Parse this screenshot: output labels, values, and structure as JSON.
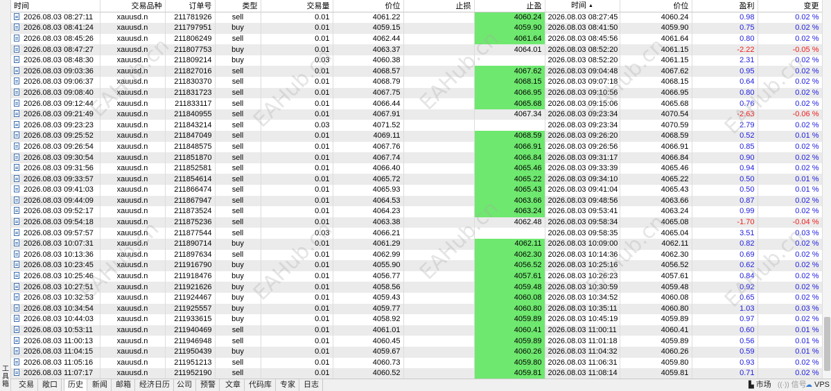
{
  "side_label": "工具箱",
  "columns": [
    "时间",
    "交易品种",
    "订单号",
    "类型",
    "交易量",
    "价位",
    "止损",
    "止盈",
    "时间",
    "价位",
    "盈利",
    "变更"
  ],
  "watermark": "EAHub.cn",
  "rows": [
    [
      "2026.08.03 08:27:11",
      "xauusd.n",
      "211781926",
      "sell",
      "0.01",
      "4061.22",
      "",
      "4060.24",
      "2026.08.03 08:27:45",
      "4060.24",
      "0.98",
      "0.02 %"
    ],
    [
      "2026.08.03 08:41:24",
      "xauusd.n",
      "211797951",
      "buy",
      "0.01",
      "4059.15",
      "",
      "4059.90",
      "2026.08.03 08:41:50",
      "4059.90",
      "0.75",
      "0.02 %"
    ],
    [
      "2026.08.03 08:45:26",
      "xauusd.n",
      "211806249",
      "sell",
      "0.01",
      "4062.44",
      "",
      "4061.64",
      "2026.08.03 08:45:56",
      "4061.64",
      "0.80",
      "0.02 %"
    ],
    [
      "2026.08.03 08:47:27",
      "xauusd.n",
      "211807753",
      "buy",
      "0.01",
      "4063.37",
      "",
      "4064.01",
      "2026.08.03 08:52:20",
      "4061.15",
      "-2.22",
      "-0.05 %"
    ],
    [
      "2026.08.03 08:48:30",
      "xauusd.n",
      "211809214",
      "buy",
      "0.03",
      "4060.38",
      "",
      "",
      "2026.08.03 08:52:20",
      "4061.15",
      "2.31",
      "0.02 %"
    ],
    [
      "2026.08.03 09:03:36",
      "xauusd.n",
      "211827016",
      "sell",
      "0.01",
      "4068.57",
      "",
      "4067.62",
      "2026.08.03 09:04:48",
      "4067.62",
      "0.95",
      "0.02 %"
    ],
    [
      "2026.08.03 09:06:37",
      "xauusd.n",
      "211830370",
      "sell",
      "0.01",
      "4068.79",
      "",
      "4068.15",
      "2026.08.03 09:07:18",
      "4068.15",
      "0.64",
      "0.02 %"
    ],
    [
      "2026.08.03 09:08:40",
      "xauusd.n",
      "211831723",
      "sell",
      "0.01",
      "4067.75",
      "",
      "4066.95",
      "2026.08.03 09:10:56",
      "4066.95",
      "0.80",
      "0.02 %"
    ],
    [
      "2026.08.03 09:12:44",
      "xauusd.n",
      "211833117",
      "sell",
      "0.01",
      "4066.44",
      "",
      "4065.68",
      "2026.08.03 09:15:06",
      "4065.68",
      "0.76",
      "0.02 %"
    ],
    [
      "2026.08.03 09:21:49",
      "xauusd.n",
      "211840955",
      "sell",
      "0.01",
      "4067.91",
      "",
      "4067.34",
      "2026.08.03 09:23:34",
      "4070.54",
      "-2.63",
      "-0.06 %"
    ],
    [
      "2026.08.03 09:23:23",
      "xauusd.n",
      "211843214",
      "sell",
      "0.03",
      "4071.52",
      "",
      "",
      "2026.08.03 09:23:34",
      "4070.59",
      "2.79",
      "0.02 %"
    ],
    [
      "2026.08.03 09:25:52",
      "xauusd.n",
      "211847049",
      "sell",
      "0.01",
      "4069.11",
      "",
      "4068.59",
      "2026.08.03 09:26:20",
      "4068.59",
      "0.52",
      "0.01 %"
    ],
    [
      "2026.08.03 09:26:54",
      "xauusd.n",
      "211848575",
      "sell",
      "0.01",
      "4067.76",
      "",
      "4066.91",
      "2026.08.03 09:26:56",
      "4066.91",
      "0.85",
      "0.02 %"
    ],
    [
      "2026.08.03 09:30:54",
      "xauusd.n",
      "211851870",
      "sell",
      "0.01",
      "4067.74",
      "",
      "4066.84",
      "2026.08.03 09:31:17",
      "4066.84",
      "0.90",
      "0.02 %"
    ],
    [
      "2026.08.03 09:31:56",
      "xauusd.n",
      "211852581",
      "sell",
      "0.01",
      "4066.40",
      "",
      "4065.46",
      "2026.08.03 09:33:39",
      "4065.46",
      "0.94",
      "0.02 %"
    ],
    [
      "2026.08.03 09:33:57",
      "xauusd.n",
      "211854614",
      "sell",
      "0.01",
      "4065.72",
      "",
      "4065.22",
      "2026.08.03 09:34:10",
      "4065.22",
      "0.50",
      "0.01 %"
    ],
    [
      "2026.08.03 09:41:03",
      "xauusd.n",
      "211866474",
      "sell",
      "0.01",
      "4065.93",
      "",
      "4065.43",
      "2026.08.03 09:41:04",
      "4065.43",
      "0.50",
      "0.01 %"
    ],
    [
      "2026.08.03 09:44:09",
      "xauusd.n",
      "211867947",
      "sell",
      "0.01",
      "4064.53",
      "",
      "4063.66",
      "2026.08.03 09:48:56",
      "4063.66",
      "0.87",
      "0.02 %"
    ],
    [
      "2026.08.03 09:52:17",
      "xauusd.n",
      "211873524",
      "sell",
      "0.01",
      "4064.23",
      "",
      "4063.24",
      "2026.08.03 09:53:41",
      "4063.24",
      "0.99",
      "0.02 %"
    ],
    [
      "2026.08.03 09:54:18",
      "xauusd.n",
      "211875236",
      "sell",
      "0.01",
      "4063.38",
      "",
      "4062.48",
      "2026.08.03 09:58:34",
      "4065.08",
      "-1.70",
      "-0.04 %"
    ],
    [
      "2026.08.03 09:57:57",
      "xauusd.n",
      "211877544",
      "sell",
      "0.03",
      "4066.21",
      "",
      "",
      "2026.08.03 09:58:35",
      "4065.04",
      "3.51",
      "0.03 %"
    ],
    [
      "2026.08.03 10:07:31",
      "xauusd.n",
      "211890714",
      "buy",
      "0.01",
      "4061.29",
      "",
      "4062.11",
      "2026.08.03 10:09:00",
      "4062.11",
      "0.82",
      "0.02 %"
    ],
    [
      "2026.08.03 10:13:36",
      "xauusd.n",
      "211897634",
      "sell",
      "0.01",
      "4062.99",
      "",
      "4062.30",
      "2026.08.03 10:14:36",
      "4062.30",
      "0.69",
      "0.02 %"
    ],
    [
      "2026.08.03 10:23:45",
      "xauusd.n",
      "211916790",
      "buy",
      "0.01",
      "4055.90",
      "",
      "4056.52",
      "2026.08.03 10:25:16",
      "4056.52",
      "0.62",
      "0.02 %"
    ],
    [
      "2026.08.03 10:25:46",
      "xauusd.n",
      "211918476",
      "buy",
      "0.01",
      "4056.77",
      "",
      "4057.61",
      "2026.08.03 10:26:23",
      "4057.61",
      "0.84",
      "0.02 %"
    ],
    [
      "2026.08.03 10:27:51",
      "xauusd.n",
      "211921626",
      "buy",
      "0.01",
      "4058.56",
      "",
      "4059.48",
      "2026.08.03 10:30:59",
      "4059.48",
      "0.92",
      "0.02 %"
    ],
    [
      "2026.08.03 10:32:53",
      "xauusd.n",
      "211924467",
      "buy",
      "0.01",
      "4059.43",
      "",
      "4060.08",
      "2026.08.03 10:34:52",
      "4060.08",
      "0.65",
      "0.02 %"
    ],
    [
      "2026.08.03 10:34:54",
      "xauusd.n",
      "211925557",
      "buy",
      "0.01",
      "4059.77",
      "",
      "4060.80",
      "2026.08.03 10:35:11",
      "4060.80",
      "1.03",
      "0.03 %"
    ],
    [
      "2026.08.03 10:44:03",
      "xauusd.n",
      "211933615",
      "buy",
      "0.01",
      "4058.92",
      "",
      "4059.89",
      "2026.08.03 10:45:19",
      "4059.89",
      "0.97",
      "0.02 %"
    ],
    [
      "2026.08.03 10:53:11",
      "xauusd.n",
      "211940469",
      "sell",
      "0.01",
      "4061.01",
      "",
      "4060.41",
      "2026.08.03 11:00:11",
      "4060.41",
      "0.60",
      "0.01 %"
    ],
    [
      "2026.08.03 11:00:13",
      "xauusd.n",
      "211946948",
      "sell",
      "0.01",
      "4060.45",
      "",
      "4059.89",
      "2026.08.03 11:01:18",
      "4059.89",
      "0.56",
      "0.01 %"
    ],
    [
      "2026.08.03 11:04:15",
      "xauusd.n",
      "211950439",
      "buy",
      "0.01",
      "4059.67",
      "",
      "4060.26",
      "2026.08.03 11:04:32",
      "4060.26",
      "0.59",
      "0.01 %"
    ],
    [
      "2026.08.03 11:05:16",
      "xauusd.n",
      "211951213",
      "sell",
      "0.01",
      "4060.73",
      "",
      "4059.80",
      "2026.08.03 11:06:31",
      "4059.80",
      "0.93",
      "0.02 %"
    ],
    [
      "2026.08.03 11:07:17",
      "xauusd.n",
      "211952190",
      "sell",
      "0.01",
      "4060.52",
      "",
      "4059.81",
      "2026.08.03 11:08:14",
      "4059.81",
      "0.71",
      "0.02 %"
    ]
  ],
  "tp_hit_rows": [
    0,
    1,
    2,
    5,
    6,
    7,
    8,
    11,
    12,
    13,
    14,
    15,
    16,
    17,
    18,
    21,
    22,
    23,
    24,
    25,
    26,
    27,
    28,
    29,
    30,
    31,
    32,
    33
  ],
  "tabs": [
    "交易",
    "敞口",
    "历史",
    "新闻",
    "邮箱",
    "经济日历",
    "公司",
    "预警",
    "文章",
    "代码库",
    "专家",
    "日志"
  ],
  "active_tab": "历史",
  "status": {
    "market": "市场",
    "signal": "信号",
    "vps": "VPS"
  },
  "colors": {
    "tp_hit": "#6ee86e",
    "profit": "#2020e0",
    "loss": "#ee1c1c",
    "row_alt": "#ebebeb"
  }
}
